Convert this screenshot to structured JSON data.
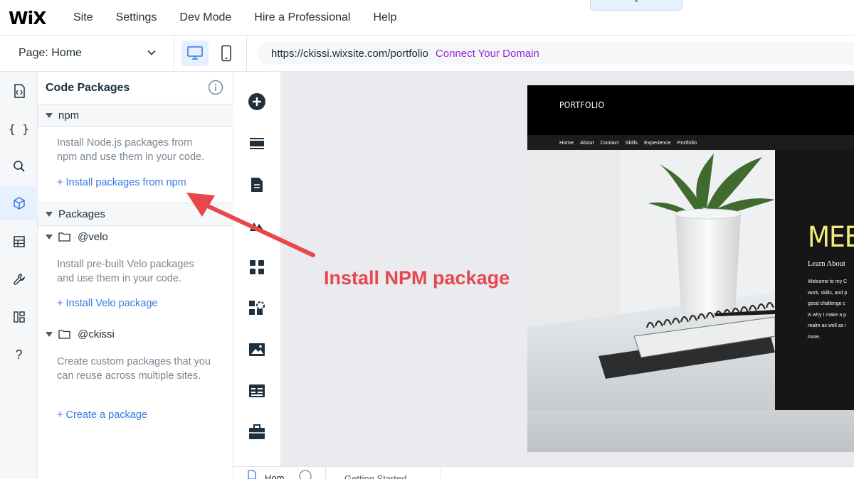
{
  "topbar": {
    "logo": "WiX",
    "menu": [
      "Site",
      "Settings",
      "Dev Mode",
      "Hire a Professional",
      "Help"
    ],
    "collapse_glyph": "⌃"
  },
  "secondbar": {
    "page_label": "Page: Home",
    "url": "https://ckissi.wixsite.com/portfolio",
    "connect_domain": "Connect Your Domain"
  },
  "rail": {
    "icons": [
      "page-code-icon",
      "braces-icon",
      "search-icon",
      "package-icon",
      "database-icon",
      "wrench-icon",
      "apps-icon",
      "help-icon"
    ],
    "braces": "{ }",
    "help": "?"
  },
  "panel": {
    "title": "Code Packages",
    "npm": {
      "label": "npm",
      "description": "Install Node.js packages from npm and use them in your code.",
      "link": "+ Install packages from npm"
    },
    "packages": {
      "label": "Packages",
      "velo": {
        "label": "@velo",
        "description": "Install pre-built Velo packages and use them in your code.",
        "link": "+ Install Velo package"
      },
      "ckissi": {
        "label": "@ckissi",
        "description": "Create custom packages that you can reuse across multiple sites.",
        "link": "+ Create a package"
      }
    }
  },
  "addbar": {
    "icons": [
      "add-icon",
      "strip-icon",
      "page-icon",
      "theme-icon",
      "apps-grid-icon",
      "puzzle-icon",
      "media-icon",
      "table-icon",
      "briefcase-icon"
    ]
  },
  "site": {
    "logo": "PORTFOLIO",
    "nav": [
      "Home",
      "About",
      "Contact",
      "Skills",
      "Experience",
      "Portfolio"
    ],
    "headline": "MEET",
    "subheading": "Learn About",
    "body": "Welcome to my C\nwork, skills, and p\ngood challenge c\nis why I make a p\nrealm as well as i\nmore."
  },
  "bottombar": {
    "tab1": "Hom",
    "tab2": "Getting Started"
  },
  "annotation": {
    "text": "Install NPM package",
    "color": "#e8474c"
  },
  "colors": {
    "accent_blue": "#3779e0",
    "connect_purple": "#9a27d5",
    "active_bg": "#e7f0ff",
    "headline_yellow": "#f3ec7a"
  }
}
